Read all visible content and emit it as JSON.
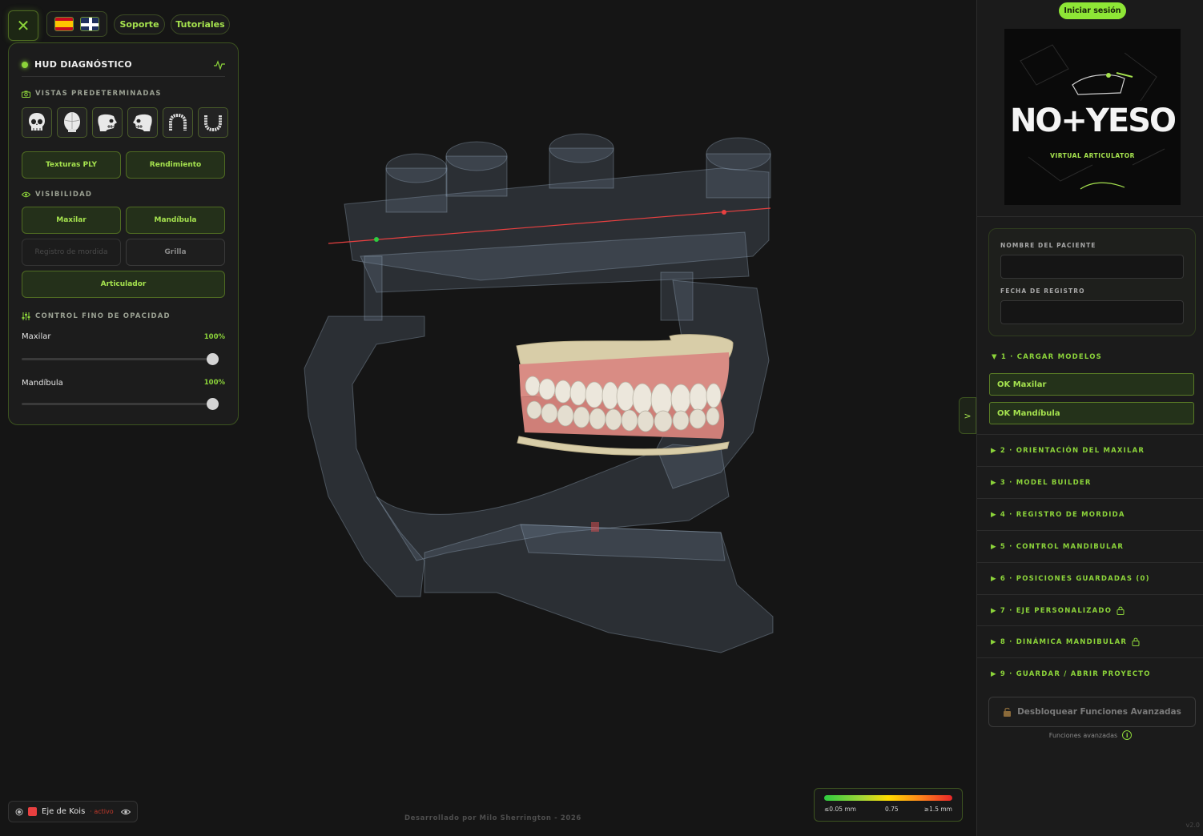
{
  "topbar": {
    "support_label": "Soporte",
    "tutorials_label": "Tutoriales"
  },
  "hud": {
    "title": "HUD DIAGNÓSTICO",
    "views_label": "VISTAS PREDETERMINADAS",
    "view_icons": [
      "skull-front-icon",
      "skull-top-icon",
      "skull-side-icon",
      "skull-side-alt-icon",
      "upper-arch-icon",
      "lower-arch-icon"
    ],
    "buttons": {
      "textures": "Texturas PLY",
      "performance": "Rendimiento"
    },
    "visibility_label": "VISIBILIDAD",
    "visibility": {
      "maxilar": "Maxilar",
      "mandibula": "Mandíbula",
      "bite_record": "Registro de mordida",
      "grid": "Grilla",
      "articulator": "Articulador"
    },
    "opacity_label": "CONTROL FINO DE OPACIDAD",
    "sliders": [
      {
        "label": "Maxilar",
        "value": "100%",
        "level": 1.0
      },
      {
        "label": "Mandíbula",
        "value": "100%",
        "level": 1.0
      }
    ]
  },
  "viewport": {
    "axis_name": "Eje de Kois",
    "axis_state": "· activo",
    "credit": "Desarrollado por Milo Sherrington - 2026",
    "legend": {
      "min": "≤0.05 mm",
      "mid": "0.75",
      "max": "≥1.5 mm"
    },
    "collapse_label": ">"
  },
  "sidebar": {
    "login_label": "Iniciar sesión",
    "logo": {
      "main": "NO+YESO",
      "sub": "VIRTUAL ARTICULATOR"
    },
    "patient": {
      "name_label": "NOMBRE DEL PACIENTE",
      "name_value": "",
      "date_label": "FECHA DE REGISTRO",
      "date_value": ""
    },
    "step1": "▼ 1 · CARGAR MODELOS",
    "ok_maxilar": "OK Maxilar",
    "ok_mandibula": "OK Mandíbula",
    "steps": [
      {
        "label": "▶ 2 · ORIENTACIÓN DEL MAXILAR",
        "locked": false
      },
      {
        "label": "▶ 3 · MODEL BUILDER",
        "locked": false
      },
      {
        "label": "▶ 4 · REGISTRO DE MORDIDA",
        "locked": false
      },
      {
        "label": "▶ 5 · CONTROL MANDIBULAR",
        "locked": false
      },
      {
        "label": "▶ 6 · POSICIONES GUARDADAS (0)",
        "locked": false
      },
      {
        "label": "▶ 7 · EJE PERSONALIZADO",
        "locked": true
      },
      {
        "label": "▶ 8 · DINÁMICA MANDIBULAR",
        "locked": true
      },
      {
        "label": "▶ 9 · GUARDAR / ABRIR PROYECTO",
        "locked": false
      }
    ],
    "unlock_label": "Desbloquear Funciones Avanzadas",
    "advanced_label": "Funciones avanzadas",
    "info_glyph": "i",
    "version": "v2.0"
  },
  "colors": {
    "accent": "#8cd43a",
    "axis": "#e84040",
    "background": "#151515"
  }
}
